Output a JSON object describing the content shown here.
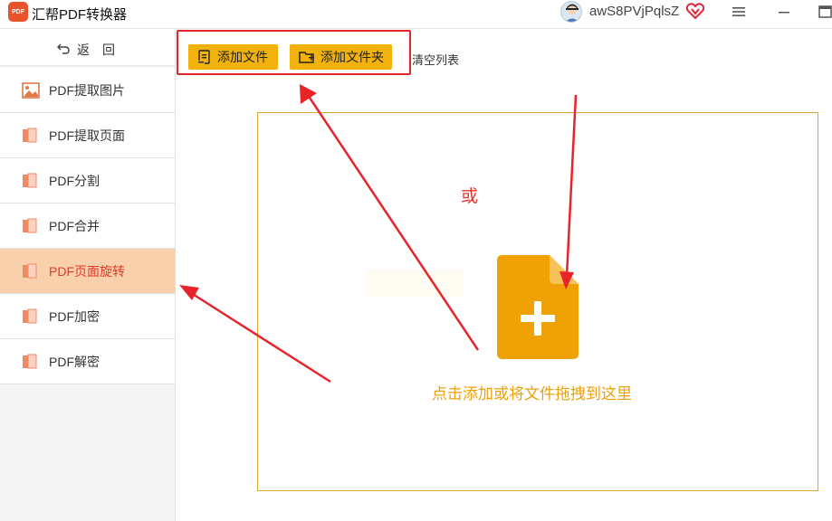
{
  "app": {
    "logo_text": "PDF",
    "title": "汇帮PDF转换器",
    "username": "awS8PVjPqlsZ"
  },
  "sidebar": {
    "back_label": "返回",
    "items": [
      {
        "label": "PDF提取图片",
        "icon": "image-icon",
        "active": false
      },
      {
        "label": "PDF提取页面",
        "icon": "pdf-file-icon",
        "active": false
      },
      {
        "label": "PDF分割",
        "icon": "pdf-file-icon",
        "active": false
      },
      {
        "label": "PDF合并",
        "icon": "pdf-file-icon",
        "active": false
      },
      {
        "label": "PDF页面旋转",
        "icon": "pdf-file-icon",
        "active": true
      },
      {
        "label": "PDF加密",
        "icon": "pdf-file-icon",
        "active": false
      },
      {
        "label": "PDF解密",
        "icon": "pdf-file-icon",
        "active": false
      }
    ]
  },
  "toolbar": {
    "add_file_label": "添加文件",
    "add_folder_label": "添加文件夹",
    "clear_label": "清空列表"
  },
  "dropzone": {
    "or_text": "或",
    "hint": "点击添加或将文件拖拽到这里",
    "icon": "file-plus-icon"
  },
  "colors": {
    "accent": "#f3b10b",
    "active_bg": "#f8d0ab",
    "active_text": "#e03a2a",
    "annotation": "#e8242a",
    "hint_text": "#eca10b",
    "dropzone_border": "#d9a82c"
  }
}
